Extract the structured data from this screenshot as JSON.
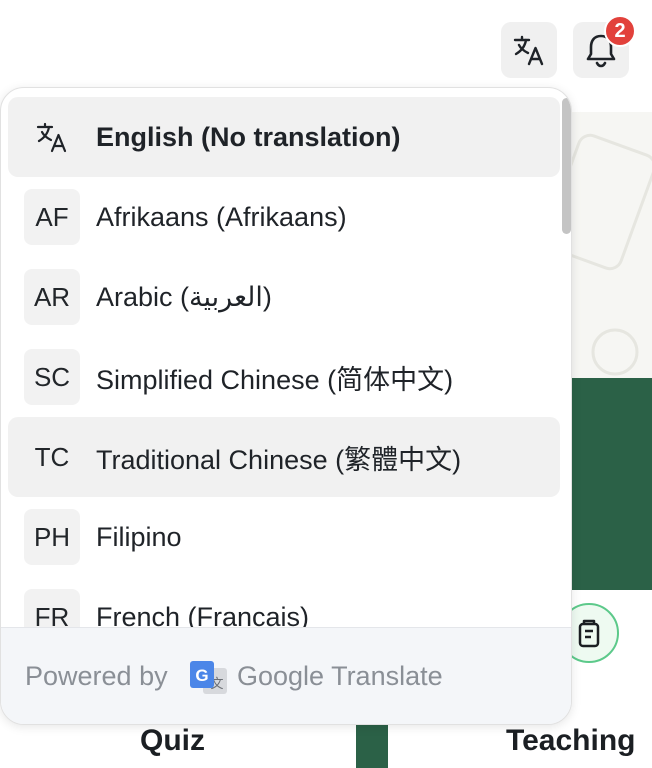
{
  "header": {
    "notification_count": "2"
  },
  "dropdown": {
    "items": [
      {
        "code": "",
        "label": "English (No translation)",
        "highlighted": true,
        "icon": "translate-icon"
      },
      {
        "code": "AF",
        "label": "Afrikaans (Afrikaans)",
        "highlighted": false
      },
      {
        "code": "AR",
        "label": "Arabic (العربية)",
        "highlighted": false
      },
      {
        "code": "SC",
        "label": "Simplified Chinese (简体中文)",
        "highlighted": false
      },
      {
        "code": "TC",
        "label": "Traditional Chinese (繁體中文)",
        "highlighted": true
      },
      {
        "code": "PH",
        "label": "Filipino",
        "highlighted": false
      },
      {
        "code": "FR",
        "label": "French (Francais)",
        "highlighted": false
      }
    ],
    "footer": {
      "powered_by": "Powered by",
      "brand": "Google Translate"
    }
  },
  "background": {
    "quiz_label": "Quiz",
    "teaching_label": "Teaching"
  },
  "colors": {
    "accent_green": "#2b6147",
    "badge_red": "#e2413b",
    "highlight_bg": "#f1f1f1"
  }
}
